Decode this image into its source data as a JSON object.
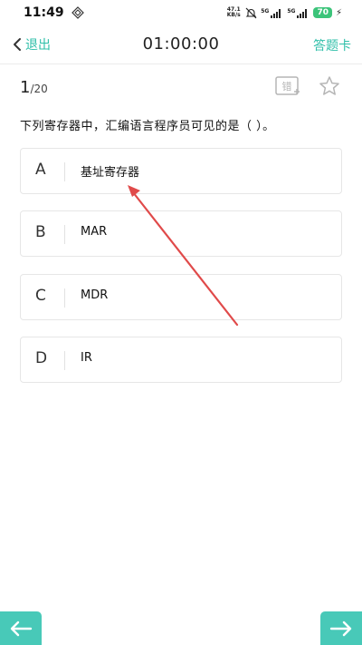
{
  "status": {
    "time": "11:49",
    "net_speed_value": "47.1",
    "net_speed_unit": "KB/s",
    "sig1": "5G",
    "sig2": "5G",
    "battery": "70"
  },
  "nav": {
    "back_label": "退出",
    "timer": "01:00:00",
    "answer_card_label": "答题卡"
  },
  "progress": {
    "current": "1",
    "total": "/20"
  },
  "toolbar": {
    "error_label": "错"
  },
  "question": {
    "text": "下列寄存器中，汇编语言程序员可见的是（  ）。"
  },
  "options": [
    {
      "letter": "A",
      "text": "基址寄存器"
    },
    {
      "letter": "B",
      "text": "MAR"
    },
    {
      "letter": "C",
      "text": "MDR"
    },
    {
      "letter": "D",
      "text": "IR"
    }
  ],
  "colors": {
    "accent": "#2fbfa9",
    "nav_button": "#48c9b8",
    "annotation_arrow": "#e04a4a",
    "battery": "#3cc47a"
  }
}
